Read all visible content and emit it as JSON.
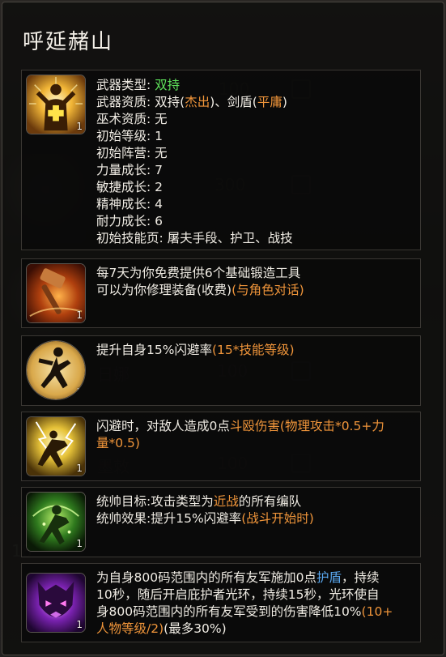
{
  "title": "呼延赭山",
  "background": {
    "ghost_numbers": [
      "100",
      "300",
      "100",
      "100"
    ],
    "ghost_names": [
      "日娜",
      "墨敕"
    ],
    "ghost_bottom": "18"
  },
  "hero": {
    "level_badge": "1",
    "attributes": [
      {
        "label": "武器类型:",
        "parts": [
          {
            "t": " 双持",
            "c": "green"
          }
        ]
      },
      {
        "label": "武器资质:",
        "parts": [
          {
            "t": " 双持(",
            "c": ""
          },
          {
            "t": "杰出",
            "c": "orange"
          },
          {
            "t": ")、剑盾(",
            "c": ""
          },
          {
            "t": "平庸",
            "c": "orange"
          },
          {
            "t": ")",
            "c": ""
          }
        ]
      },
      {
        "label": "巫术资质:",
        "parts": [
          {
            "t": " 无",
            "c": ""
          }
        ]
      },
      {
        "label": "初始等级:",
        "parts": [
          {
            "t": " 1",
            "c": ""
          }
        ]
      },
      {
        "label": "初始阵营:",
        "parts": [
          {
            "t": " 无",
            "c": ""
          }
        ]
      },
      {
        "label": "力量成长:",
        "parts": [
          {
            "t": " 7",
            "c": ""
          }
        ]
      },
      {
        "label": "敏捷成长:",
        "parts": [
          {
            "t": " 2",
            "c": ""
          }
        ]
      },
      {
        "label": "精神成长:",
        "parts": [
          {
            "t": " 4",
            "c": ""
          }
        ]
      },
      {
        "label": "耐力成长:",
        "parts": [
          {
            "t": " 6",
            "c": ""
          }
        ]
      },
      {
        "label": "初始技能页:",
        "parts": [
          {
            "t": " 屠夫手段、护卫、战技",
            "c": ""
          }
        ]
      }
    ]
  },
  "skills": [
    {
      "icon": "hammer-icon",
      "level_badge": "1",
      "lines": [
        [
          {
            "t": "每7天为你免费提供6个基础锻造工具",
            "c": ""
          }
        ],
        [
          {
            "t": "可以为你修理装备(收费)",
            "c": ""
          },
          {
            "t": "(与角色对话)",
            "c": "orange"
          }
        ]
      ]
    },
    {
      "icon": "dodge-pose-icon",
      "level_badge": "1",
      "lines": [
        [
          {
            "t": "提升自身15%闪避率",
            "c": ""
          },
          {
            "t": "(15*技能等级)",
            "c": "orange"
          }
        ]
      ]
    },
    {
      "icon": "lightning-strike-icon",
      "level_badge": "1",
      "lines": [
        [
          {
            "t": "闪避时，对敌人造成0点",
            "c": ""
          },
          {
            "t": "斗殴伤害",
            "c": "orange"
          },
          {
            "t": "(物理攻击*0.5+力",
            "c": "orange"
          }
        ],
        [
          {
            "t": "量*0.5)",
            "c": "orange"
          }
        ]
      ]
    },
    {
      "icon": "command-aura-icon",
      "level_badge": "1",
      "lines": [
        [
          {
            "t": "统帅目标:攻击类型为",
            "c": ""
          },
          {
            "t": "近战",
            "c": "orange"
          },
          {
            "t": "的所有编队",
            "c": ""
          }
        ],
        [
          {
            "t": "统帅效果:提升15%闪避率",
            "c": ""
          },
          {
            "t": "(战斗开始时)",
            "c": "orange"
          }
        ]
      ]
    },
    {
      "icon": "shield-mask-icon",
      "level_badge": "1",
      "lines": [
        [
          {
            "t": "为自身800码范围内的所有友军施加0点",
            "c": ""
          },
          {
            "t": "护盾",
            "c": "blue"
          },
          {
            "t": "，持续",
            "c": ""
          }
        ],
        [
          {
            "t": "10秒，随后开启庇护者光环，持续15秒，光环使自",
            "c": ""
          }
        ],
        [
          {
            "t": "身800码范围内的所有友军受到的伤害降低10%",
            "c": ""
          },
          {
            "t": "(10+",
            "c": "orange"
          }
        ],
        [
          {
            "t": "人物等级/2)",
            "c": "orange"
          },
          {
            "t": "(最多30%)",
            "c": ""
          }
        ]
      ]
    }
  ]
}
